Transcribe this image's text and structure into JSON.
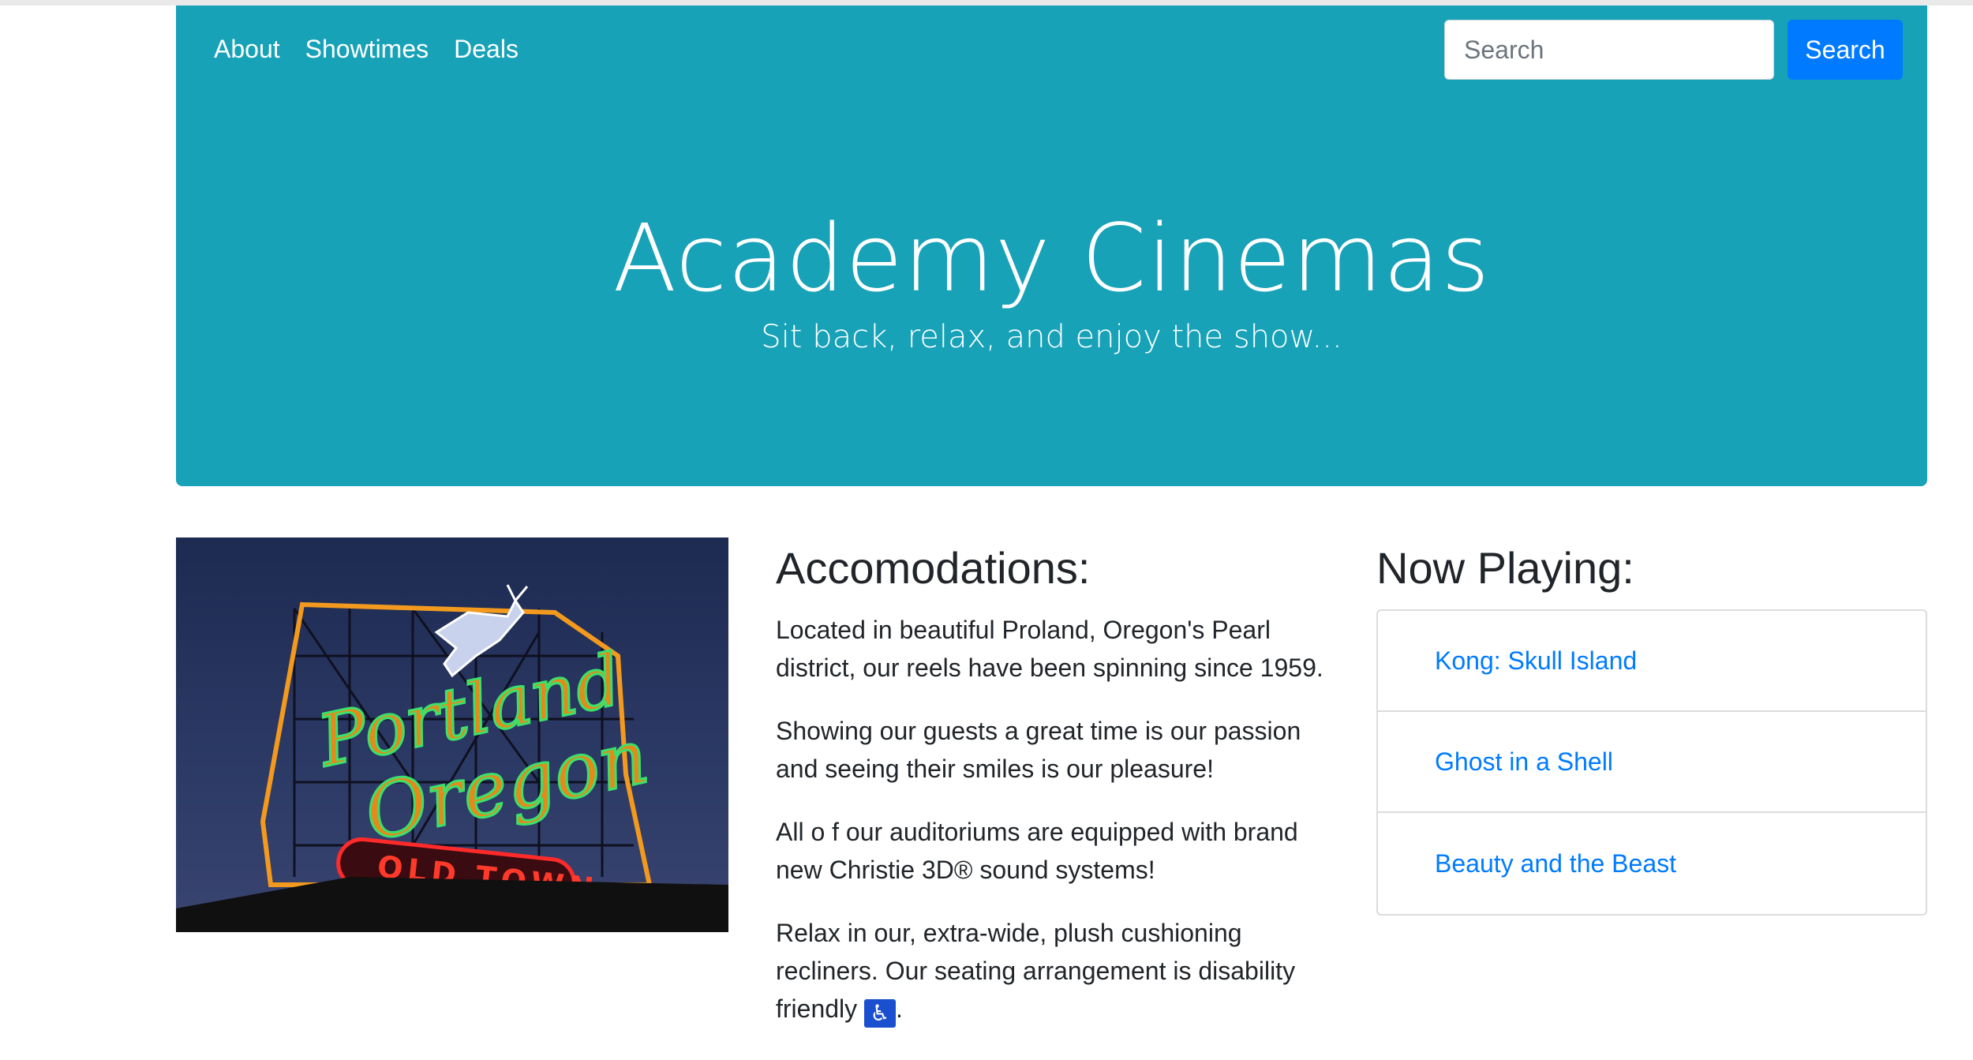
{
  "nav": {
    "links": [
      "About",
      "Showtimes",
      "Deals"
    ],
    "search_placeholder": "Search",
    "search_button": "Search"
  },
  "hero": {
    "title": "Academy Cinemas",
    "subtitle": "Sit back, relax, and enjoy the show..."
  },
  "image": {
    "sign_top": "Portland",
    "sign_bottom": "Oregon",
    "sign_banner": "OLD TOWN"
  },
  "accomodations": {
    "heading": "Accomodations:",
    "p1": "Located in beautiful Proland, Oregon's Pearl district, our reels have been spinning since 1959.",
    "p2": "Showing our guests a great time is our passion and seeing their smiles is our pleasure!",
    "p3": "All o f our auditoriums are equipped with brand new Christie 3D® sound systems!",
    "p4_text": "Relax in our, extra-wide, plush cushioning recliners. Our seating arrangement is disability friendly",
    "p4_icon": "♿",
    "p4_end": "."
  },
  "now_playing": {
    "heading": "Now Playing:",
    "movies": [
      "Kong: Skull Island",
      "Ghost in a Shell",
      "Beauty and the Beast"
    ]
  },
  "colors": {
    "teal": "#17a2b8",
    "primary": "#007bff"
  }
}
